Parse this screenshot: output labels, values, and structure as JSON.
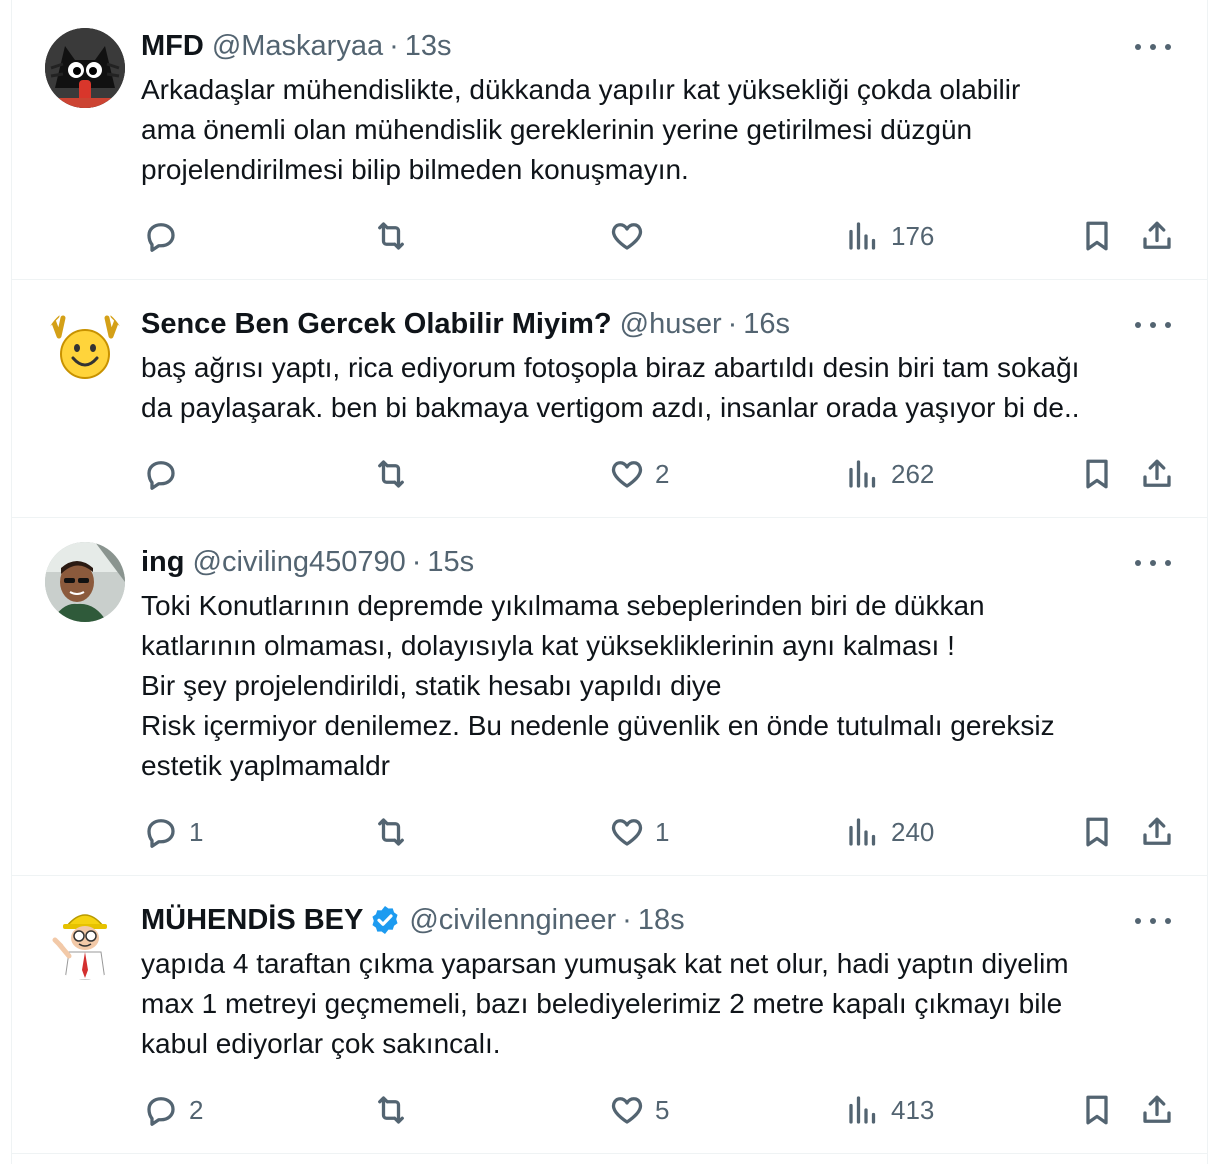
{
  "tweets": [
    {
      "name": "MFD",
      "handle": "@Maskaryaa",
      "separator": "·",
      "time": "13s",
      "verified": false,
      "avatar_icon": "black-cat-avatar-icon",
      "text": "Arkadaşlar mühendislikte, dükkanda yapılır kat yüksekliği çokda olabilir\nama önemli olan mühendislik gereklerinin yerine getirilmesi düzgün\nprojelendirilmesi bilip bilmeden konuşmayın.",
      "replies": "",
      "retweets": "",
      "likes": "",
      "views": "176"
    },
    {
      "name": "Sence Ben Gercek Olabilir Miyim?",
      "handle": "@huser",
      "separator": "·",
      "time": "16s",
      "verified": false,
      "avatar_icon": "smiley-raised-hands-avatar-icon",
      "text": "baş ağrısı yaptı, rica ediyorum fotoşopla biraz abartıldı desin biri tam sokağı\nda paylaşarak. ben bi bakmaya vertigom azdı, insanlar orada yaşıyor bi de..",
      "replies": "",
      "retweets": "",
      "likes": "2",
      "views": "262"
    },
    {
      "name": "ing",
      "handle": "@civiling450790",
      "separator": "·",
      "time": "15s",
      "verified": false,
      "avatar_icon": "man-in-car-avatar-icon",
      "text": "Toki Konutlarının depremde yıkılmama sebeplerinden biri de dükkan\nkatlarının olmaması, dolayısıyla kat yüksekliklerinin aynı kalması !\nBir şey projelendirildi, statik hesabı yapıldı diye\nRisk içermiyor denilemez. Bu nedenle güvenlik en önde tutulmalı gereksiz\nestetik yaplmamaldr",
      "replies": "1",
      "retweets": "",
      "likes": "1",
      "views": "240"
    },
    {
      "name": "MÜHENDİS BEY",
      "handle": "@civilenngineer",
      "separator": "·",
      "time": "18s",
      "verified": true,
      "avatar_icon": "engineer-hardhat-avatar-icon",
      "text": "yapıda 4 taraftan çıkma yaparsan yumuşak kat net olur, hadi yaptın diyelim\nmax 1 metreyi geçmemeli, bazı belediyelerimiz 2 metre kapalı çıkmayı bile\nkabul ediyorlar çok sakıncalı.",
      "replies": "2",
      "retweets": "",
      "likes": "5",
      "views": "413"
    }
  ],
  "colors": {
    "text": "#0f1419",
    "secondary": "#536471",
    "border": "#eff3f4",
    "verified": "#1d9bf0"
  }
}
